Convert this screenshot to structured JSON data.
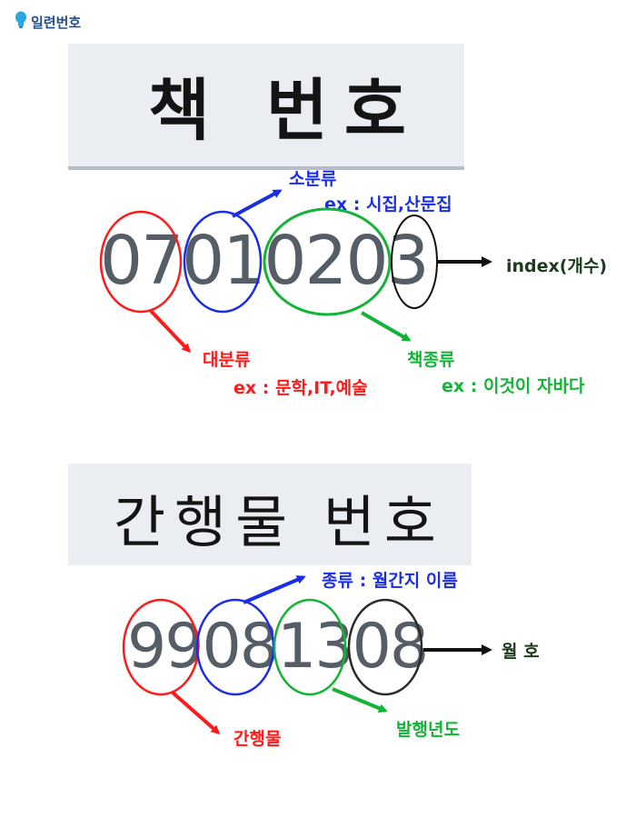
{
  "header": {
    "icon": "lightbulb-icon",
    "title": "일련번호"
  },
  "book": {
    "title": "책 번호",
    "code": "07010203",
    "labels": {
      "sub": "소분류",
      "sub_ex": "ex : 시집,산문집",
      "index": "index(개수)",
      "major": "대분류",
      "major_ex": "ex : 문학,IT,예술",
      "kind": "책종류",
      "kind_ex": "ex : 이것이 자바다"
    }
  },
  "periodical": {
    "title": "간행물 번호",
    "code": "99081308",
    "labels": {
      "kind": "종류 : 월간지 이름",
      "issue": "월 호",
      "pub": "간행물",
      "year": "발행년도"
    }
  },
  "colors": {
    "red": "#ff1a1a",
    "blue": "#1a2ee6",
    "green": "#12b336",
    "black": "#111111"
  }
}
